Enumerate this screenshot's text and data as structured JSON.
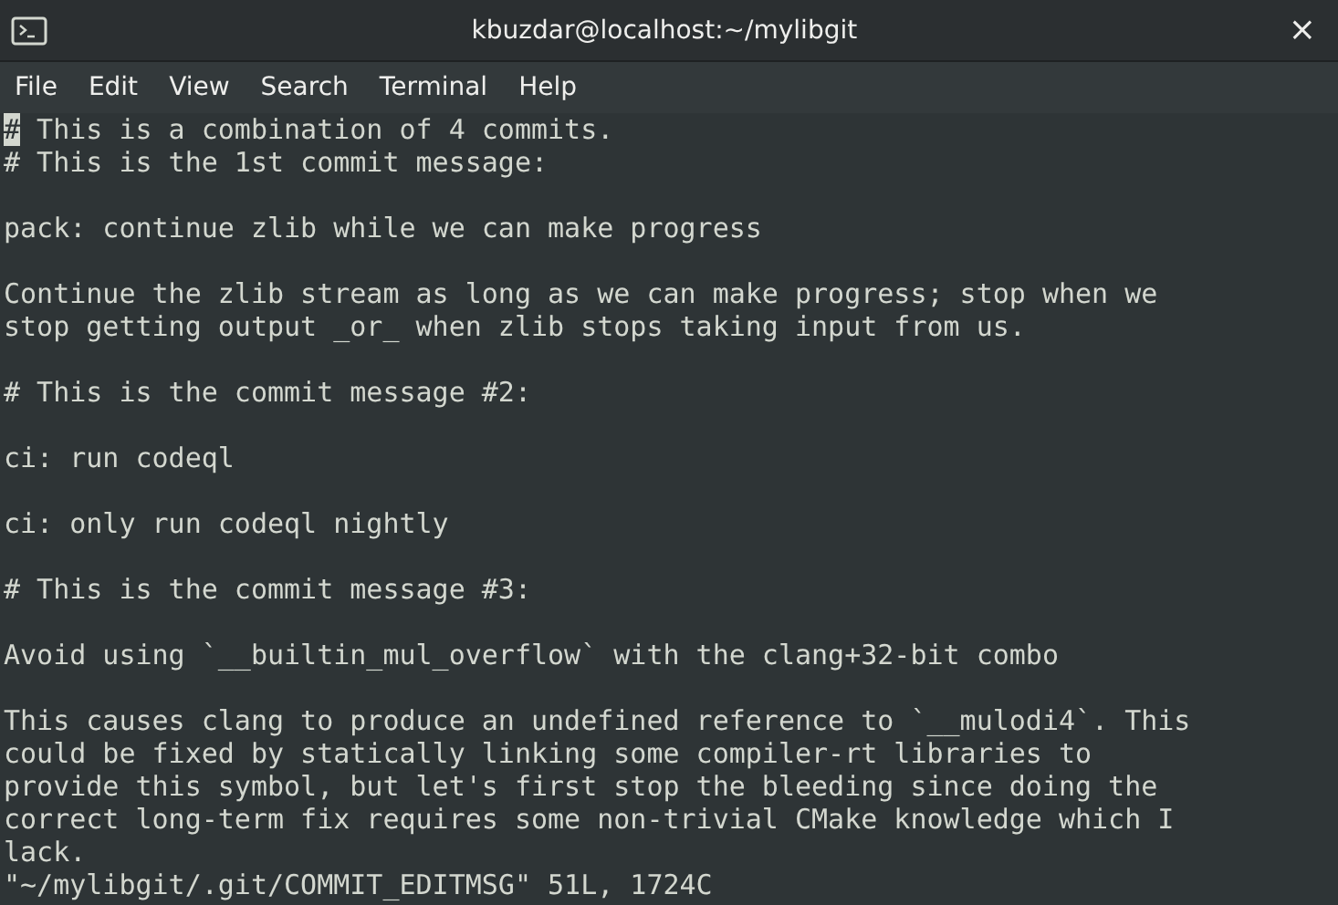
{
  "window": {
    "title": "kbuzdar@localhost:~/mylibgit",
    "close": "×"
  },
  "menu": [
    "File",
    "Edit",
    "View",
    "Search",
    "Terminal",
    "Help"
  ],
  "terminal": {
    "lines": [
      {
        "kind": "text",
        "text": "# This is a combination of 4 commits.",
        "cursor": true
      },
      {
        "kind": "text",
        "text": "# This is the 1st commit message:",
        "cursor": false
      },
      {
        "kind": "blank"
      },
      {
        "kind": "text",
        "text": "pack: continue zlib while we can make progress",
        "cursor": false
      },
      {
        "kind": "blank"
      },
      {
        "kind": "text",
        "text": "Continue the zlib stream as long as we can make progress; stop when we",
        "cursor": false
      },
      {
        "kind": "text",
        "text": "stop getting output _or_ when zlib stops taking input from us.",
        "cursor": false
      },
      {
        "kind": "blank"
      },
      {
        "kind": "text",
        "text": "# This is the commit message #2:",
        "cursor": false
      },
      {
        "kind": "blank"
      },
      {
        "kind": "text",
        "text": "ci: run codeql",
        "cursor": false
      },
      {
        "kind": "blank"
      },
      {
        "kind": "text",
        "text": "ci: only run codeql nightly",
        "cursor": false
      },
      {
        "kind": "blank"
      },
      {
        "kind": "text",
        "text": "# This is the commit message #3:",
        "cursor": false
      },
      {
        "kind": "blank"
      },
      {
        "kind": "text",
        "text": "Avoid using `__builtin_mul_overflow` with the clang+32-bit combo",
        "cursor": false
      },
      {
        "kind": "blank"
      },
      {
        "kind": "text",
        "text": "This causes clang to produce an undefined reference to `__mulodi4`. This",
        "cursor": false
      },
      {
        "kind": "text",
        "text": "could be fixed by statically linking some compiler-rt libraries to",
        "cursor": false
      },
      {
        "kind": "text",
        "text": "provide this symbol, but let's first stop the bleeding since doing the",
        "cursor": false
      },
      {
        "kind": "text",
        "text": "correct long-term fix requires some non-trivial CMake knowledge which I",
        "cursor": false
      },
      {
        "kind": "text",
        "text": "lack.",
        "cursor": false
      }
    ],
    "status": "\"~/mylibgit/.git/COMMIT_EDITMSG\" 51L, 1724C"
  }
}
